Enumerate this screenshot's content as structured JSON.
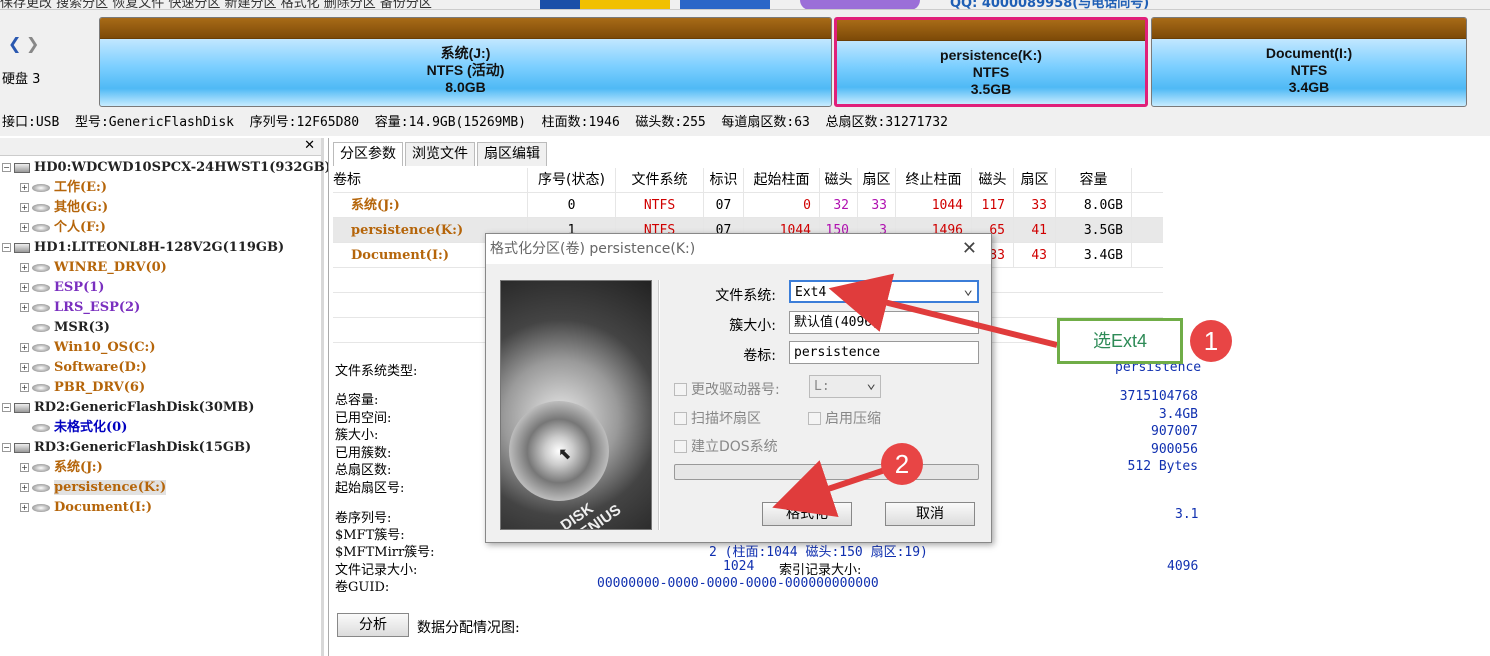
{
  "top": {
    "menu_text": "保存更改  搜索分区  恢复文件  快速分区  新建分区  格式化  删除分区  备份分区",
    "qq_text": "QQ: 4000089958(与电话同号)"
  },
  "disk_nav": {
    "label": "硬盘 3"
  },
  "partitions_map": [
    {
      "l1": "系统(J:)",
      "l2": "NTFS (活动)",
      "l3": "8.0GB"
    },
    {
      "l1": "persistence(K:)",
      "l2": "NTFS",
      "l3": "3.5GB"
    },
    {
      "l1": "Document(I:)",
      "l2": "NTFS",
      "l3": "3.4GB"
    }
  ],
  "infobar": "接口:USB  型号:GenericFlashDisk  序列号:12F65D80  容量:14.9GB(15269MB)  柱面数:1946  磁头数:255  每道扇区数:63  总扇区数:31271732",
  "tree": [
    {
      "text": "HD0:WDCWD10SPCX-24HWST1(932GB)",
      "color": "dark",
      "level": 0,
      "icon": "disk"
    },
    {
      "text": "工作(E:)",
      "color": "brown",
      "level": 1,
      "icon": "part"
    },
    {
      "text": "其他(G:)",
      "color": "brown",
      "level": 1,
      "icon": "part"
    },
    {
      "text": "个人(F:)",
      "color": "brown",
      "level": 1,
      "icon": "part"
    },
    {
      "text": "HD1:LITEONL8H-128V2G(119GB)",
      "color": "dark",
      "level": 0,
      "icon": "disk"
    },
    {
      "text": "WINRE_DRV(0)",
      "color": "brown",
      "level": 1,
      "icon": "part"
    },
    {
      "text": "ESP(1)",
      "color": "purple",
      "level": 1,
      "icon": "part"
    },
    {
      "text": "LRS_ESP(2)",
      "color": "purple",
      "level": 1,
      "icon": "part"
    },
    {
      "text": "MSR(3)",
      "color": "dark",
      "level": 1,
      "icon": "part"
    },
    {
      "text": "Win10_OS(C:)",
      "color": "brown",
      "level": 1,
      "icon": "part"
    },
    {
      "text": "Software(D:)",
      "color": "brown",
      "level": 1,
      "icon": "part"
    },
    {
      "text": "PBR_DRV(6)",
      "color": "brown",
      "level": 1,
      "icon": "part"
    },
    {
      "text": "RD2:GenericFlashDisk(30MB)",
      "color": "dark",
      "level": 0,
      "icon": "disk"
    },
    {
      "text": "未格式化(0)",
      "color": "navy",
      "level": 1,
      "icon": "part"
    },
    {
      "text": "RD3:GenericFlashDisk(15GB)",
      "color": "dark",
      "level": 0,
      "icon": "disk"
    },
    {
      "text": "系统(J:)",
      "color": "brown",
      "level": 1,
      "icon": "part"
    },
    {
      "text": "persistence(K:)",
      "color": "brown",
      "level": 1,
      "icon": "part",
      "selected": true
    },
    {
      "text": "Document(I:)",
      "color": "brown",
      "level": 1,
      "icon": "part"
    }
  ],
  "tabs": [
    "分区参数",
    "浏览文件",
    "扇区编辑"
  ],
  "grid": {
    "headers": [
      "卷标",
      "序号(状态)",
      "文件系统",
      "标识",
      "起始柱面",
      "磁头",
      "扇区",
      "终止柱面",
      "磁头",
      "扇区",
      "容量"
    ],
    "rows": [
      [
        "系统(J:)",
        "0",
        "NTFS",
        "07",
        "0",
        "32",
        "33",
        "1044",
        "117",
        "33",
        "8.0GB"
      ],
      [
        "persistence(K:)",
        "1",
        "NTFS",
        "07",
        "1044",
        "150",
        "3",
        "1496",
        "65",
        "41",
        "3.5GB"
      ],
      [
        "Document(I:)",
        "2",
        "NTFS",
        "07",
        "1496",
        "66",
        "1",
        "1946",
        "133",
        "43",
        "3.4GB"
      ]
    ]
  },
  "details": {
    "fs_type_label": "文件系统类型:",
    "fs_type_value": "persistence",
    "rows": [
      {
        "label": "总容量:",
        "value": "3715104768"
      },
      {
        "label": "已用空间:",
        "value": "3.4GB"
      },
      {
        "label": "簇大小:",
        "value": "907007"
      },
      {
        "label": "已用簇数:",
        "value": "900056"
      },
      {
        "label": "总扇区数:",
        "value": "512 Bytes"
      },
      {
        "label": "起始扇区号:",
        "value": ""
      }
    ],
    "serial_label": "卷序列号:",
    "serial_value": "3.1",
    "mft_label": "$MFT簇号:",
    "mftmirr_label": "$MFTMirr簇号:",
    "mftmirr_value": "2 (柱面:1044 磁头:150 扇区:19)",
    "record_label": "文件记录大小:",
    "record_value": "1024",
    "index_label": "索引记录大小:",
    "index_value": "4096",
    "guid_label": "卷GUID:",
    "guid_value": "00000000-0000-0000-0000-000000000000",
    "analyze_button": "分析",
    "alloc_label": "数据分配情况图:"
  },
  "dialog": {
    "title": "格式化分区(卷) persistence(K:)",
    "fs_label": "文件系统:",
    "fs_value": "Ext4",
    "cluster_label": "簇大小:",
    "cluster_value": "默认值(4096)",
    "volume_label": "卷标:",
    "volume_value": "persistence",
    "drive_letter_label": "更改驱动器号:",
    "drive_letter_value": "L:",
    "scan_bad_label": "扫描坏扇区",
    "compress_label": "启用压缩",
    "dos_label": "建立DOS系统",
    "format_button": "格式化",
    "cancel_button": "取消",
    "brand": "DISK GENIUS"
  },
  "annotations": {
    "note": "选Ext4",
    "badge1": "1",
    "badge2": "2"
  }
}
